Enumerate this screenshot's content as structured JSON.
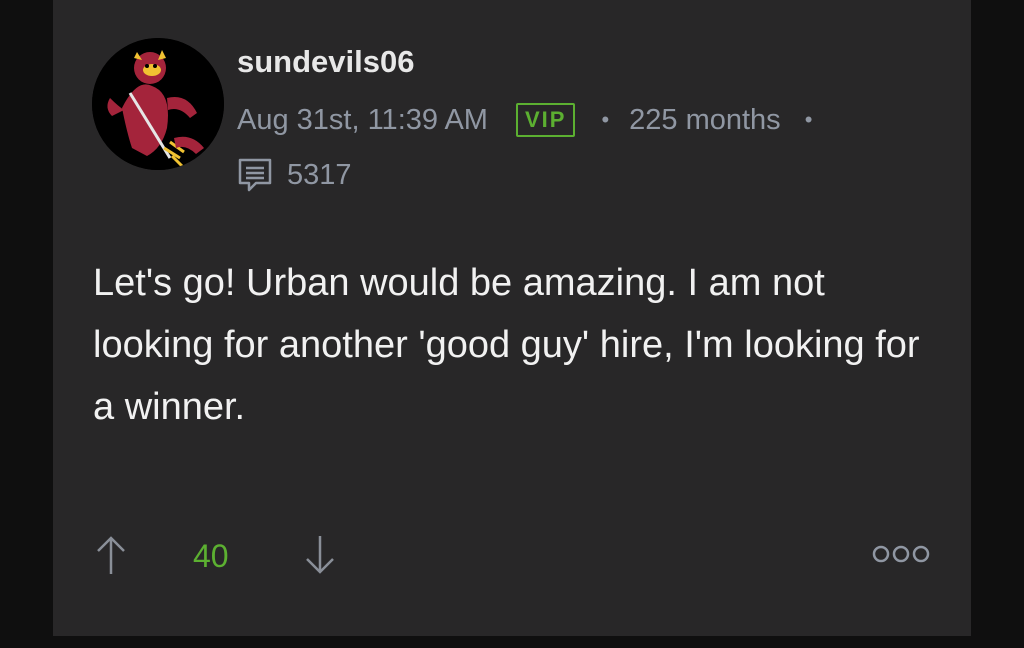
{
  "post": {
    "username": "sundevils06",
    "timestamp": "Aug 31st, 11:39 AM",
    "badge": "VIP",
    "separator": "•",
    "tenure": "225 months",
    "post_count": "5317",
    "body": "Let's go! Urban would be amazing. I am not looking for another 'good guy' hire, I'm looking for a winner.",
    "score": "40"
  },
  "icons": {
    "avatar": "sun-devil-mascot-avatar",
    "posts": "message-icon",
    "upvote": "arrow-up-icon",
    "downvote": "arrow-down-icon",
    "more": "more-options-icon"
  },
  "colors": {
    "background": "#282728",
    "accent_green": "#5cb031",
    "meta_gray": "#9097a3",
    "text": "#f1f1f1"
  }
}
